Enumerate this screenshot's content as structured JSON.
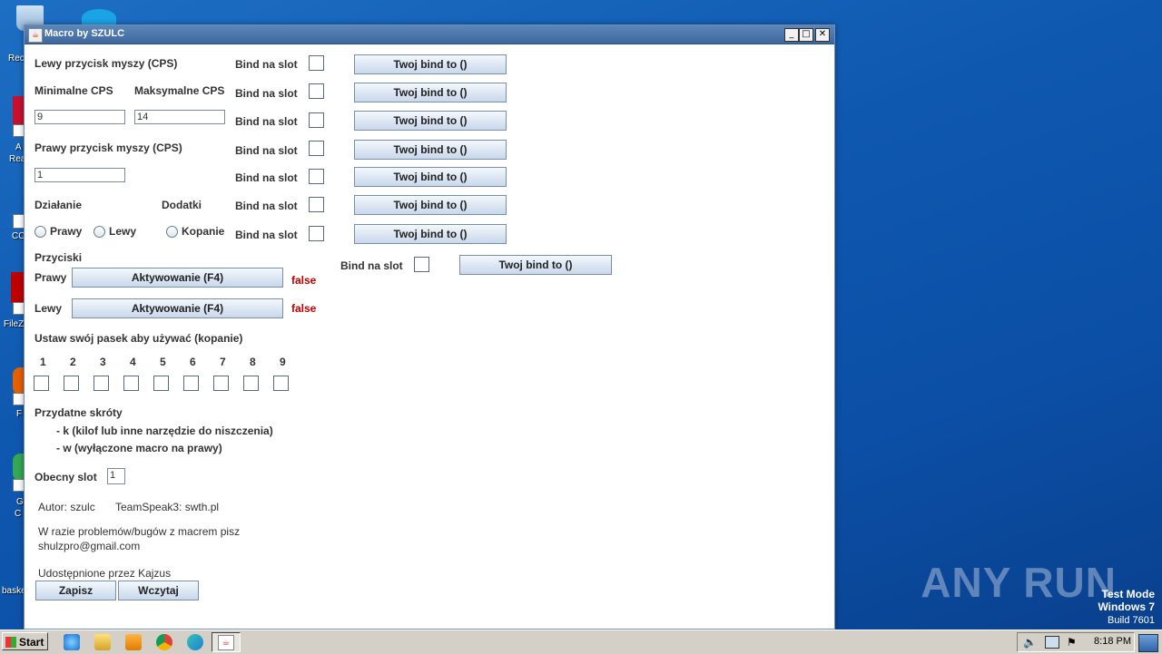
{
  "desktop": {
    "labels": [
      "Rec",
      "A",
      "Rea",
      "CC",
      "FileZ",
      "F",
      "G",
      "C",
      "baske"
    ]
  },
  "window": {
    "title": "Macro by SZULC",
    "controls": {
      "minimize": "_",
      "maximize": "□",
      "close": "✕"
    }
  },
  "form": {
    "left_mouse_label": "Lewy przycisk myszy (CPS)",
    "min_cps_label": "Minimalne CPS",
    "max_cps_label": "Maksymalne CPS",
    "min_cps_value": "9",
    "max_cps_value": "14",
    "right_mouse_label": "Prawy przycisk myszy (CPS)",
    "right_cps_value": "1",
    "action_label": "Działanie",
    "extras_label": "Dodatki",
    "radio_right": "Prawy",
    "radio_left": "Lewy",
    "radio_digging": "Kopanie",
    "buttons_label": "Przyciski",
    "right_btn_row_label": "Prawy",
    "left_btn_row_label": "Lewy",
    "activate_label": "Aktywowanie (F4)",
    "right_status": "false",
    "left_status": "false",
    "hotbar_label": "Ustaw swój pasek aby używać (kopanie)",
    "hotbar_slots": [
      "1",
      "2",
      "3",
      "4",
      "5",
      "6",
      "7",
      "8",
      "9"
    ],
    "shortcuts_label": "Przydatne skróty",
    "shortcut_k": "- k  (kilof lub inne narzędzie do niszczenia)",
    "shortcut_w": "- w (wyłączone macro na prawy)",
    "current_slot_label": "Obecny slot",
    "current_slot_value": "1",
    "author": "Autor: szulc",
    "teamspeak": "TeamSpeak3: swth.pl",
    "problems_line1": "W razie problemów/bugów z macrem pisz",
    "problems_line2": "shulzpro@gmail.com",
    "shared_by": "Udostępnione przez Kajzus",
    "save_label": "Zapisz",
    "load_label": "Wczytaj"
  },
  "binds": {
    "slot_label": "Bind na slot",
    "button_label": "Twoj bind to ()"
  },
  "taskbar": {
    "start_label": "Start",
    "clock": "8:18 PM"
  },
  "watermark": {
    "brand": "ANY RUN",
    "line1": "Test Mode",
    "line2": "Windows 7",
    "line3": "Build 7601"
  }
}
